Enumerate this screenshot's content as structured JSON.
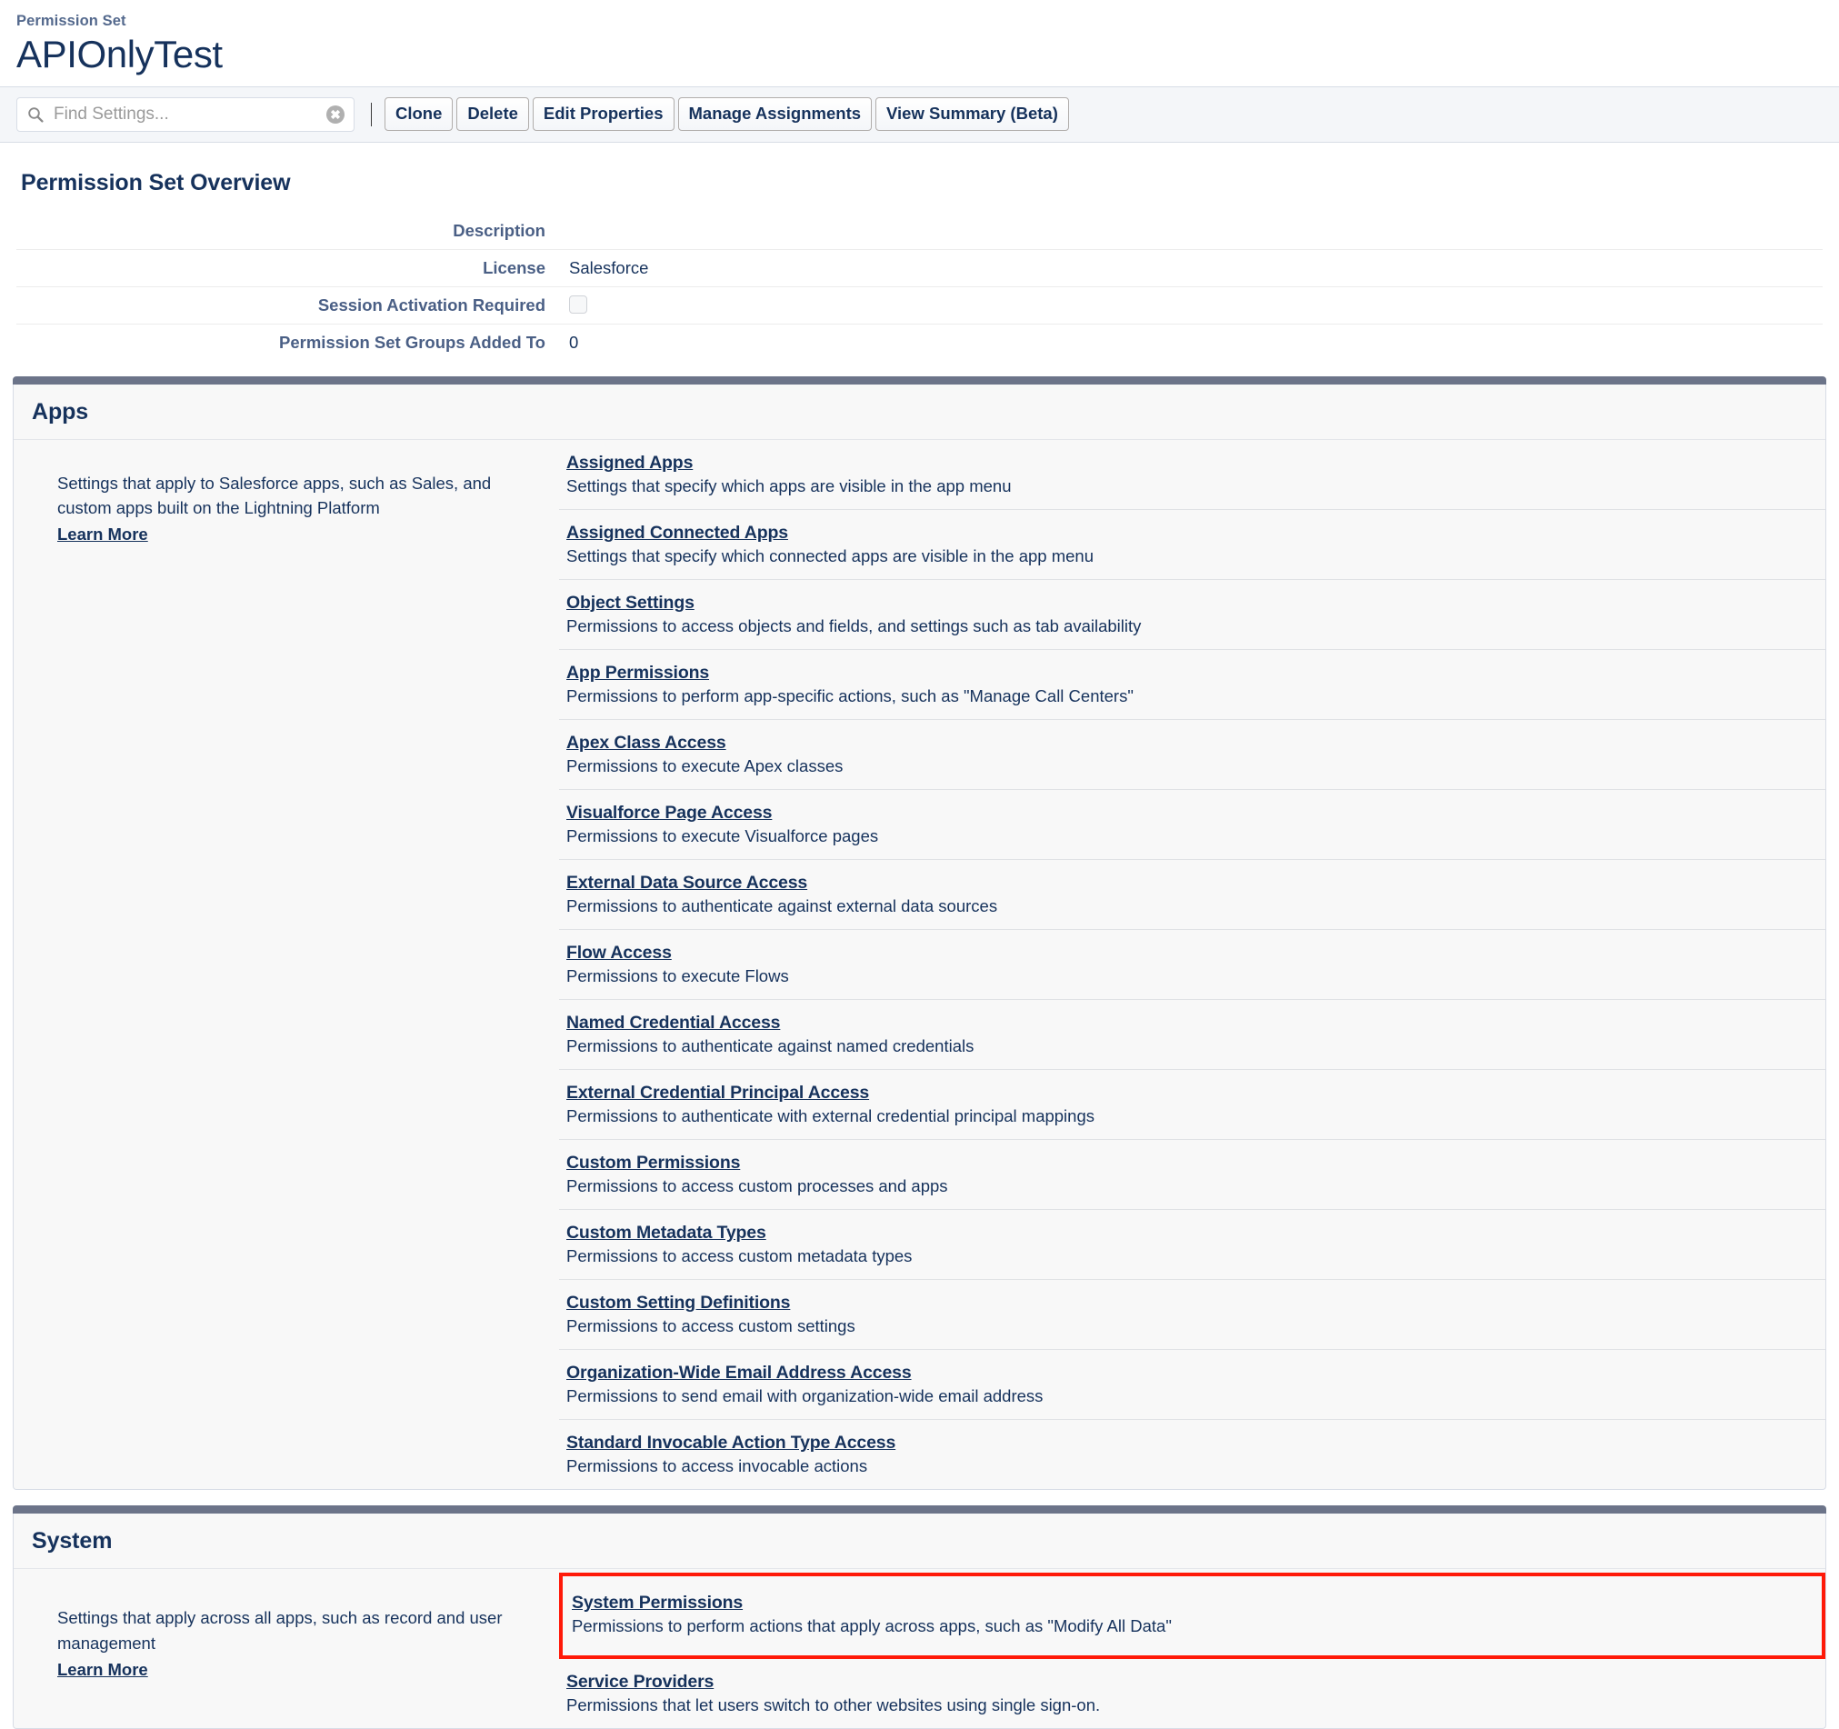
{
  "header": {
    "eyebrow": "Permission Set",
    "title": "APIOnlyTest"
  },
  "toolbar": {
    "search_placeholder": "Find Settings...",
    "search_value": "",
    "clear_label": "✖",
    "buttons": [
      {
        "label": "Clone"
      },
      {
        "label": "Delete"
      },
      {
        "label": "Edit Properties"
      },
      {
        "label": "Manage Assignments"
      },
      {
        "label": "View Summary (Beta)"
      }
    ]
  },
  "overview": {
    "title": "Permission Set Overview",
    "rows": [
      {
        "label": "Description",
        "value": "",
        "type": "text"
      },
      {
        "label": "License",
        "value": "Salesforce",
        "type": "text"
      },
      {
        "label": "Session Activation Required",
        "value": "",
        "type": "checkbox",
        "checked": false
      },
      {
        "label": "Permission Set Groups Added To",
        "value": "0",
        "type": "text"
      }
    ]
  },
  "sections": [
    {
      "id": "apps",
      "title": "Apps",
      "description": "Settings that apply to Salesforce apps, such as Sales, and custom apps built on the Lightning Platform",
      "learn_more": "Learn More",
      "links": [
        {
          "title": "Assigned Apps",
          "sub": "Settings that specify which apps are visible in the app menu",
          "highlighted": false
        },
        {
          "title": "Assigned Connected Apps",
          "sub": "Settings that specify which connected apps are visible in the app menu",
          "highlighted": false
        },
        {
          "title": "Object Settings",
          "sub": "Permissions to access objects and fields, and settings such as tab availability",
          "highlighted": false
        },
        {
          "title": "App Permissions",
          "sub": "Permissions to perform app-specific actions, such as \"Manage Call Centers\"",
          "highlighted": false
        },
        {
          "title": "Apex Class Access",
          "sub": "Permissions to execute Apex classes",
          "highlighted": false
        },
        {
          "title": "Visualforce Page Access",
          "sub": "Permissions to execute Visualforce pages",
          "highlighted": false
        },
        {
          "title": "External Data Source Access",
          "sub": "Permissions to authenticate against external data sources",
          "highlighted": false
        },
        {
          "title": "Flow Access",
          "sub": "Permissions to execute Flows",
          "highlighted": false
        },
        {
          "title": "Named Credential Access",
          "sub": "Permissions to authenticate against named credentials",
          "highlighted": false
        },
        {
          "title": "External Credential Principal Access",
          "sub": "Permissions to authenticate with external credential principal mappings",
          "highlighted": false
        },
        {
          "title": "Custom Permissions",
          "sub": "Permissions to access custom processes and apps",
          "highlighted": false
        },
        {
          "title": "Custom Metadata Types",
          "sub": "Permissions to access custom metadata types",
          "highlighted": false
        },
        {
          "title": "Custom Setting Definitions",
          "sub": "Permissions to access custom settings",
          "highlighted": false
        },
        {
          "title": "Organization-Wide Email Address Access",
          "sub": "Permissions to send email with organization-wide email address",
          "highlighted": false
        },
        {
          "title": "Standard Invocable Action Type Access",
          "sub": "Permissions to access invocable actions",
          "highlighted": false
        }
      ]
    },
    {
      "id": "system",
      "title": "System",
      "description": "Settings that apply across all apps, such as record and user management",
      "learn_more": "Learn More",
      "links": [
        {
          "title": "System Permissions",
          "sub": "Permissions to perform actions that apply across apps, such as \"Modify All Data\"",
          "highlighted": true
        },
        {
          "title": "Service Providers",
          "sub": "Permissions that let users switch to other websites using single sign-on.",
          "highlighted": false
        }
      ]
    }
  ],
  "colors": {
    "panel_top_bar": "#6c7489",
    "highlight_border": "#ff1a09",
    "text_primary": "#16325c",
    "label_text": "#4a5f85",
    "panel_bg": "#f8f8f8",
    "toolbar_bg": "#f4f6f9"
  }
}
